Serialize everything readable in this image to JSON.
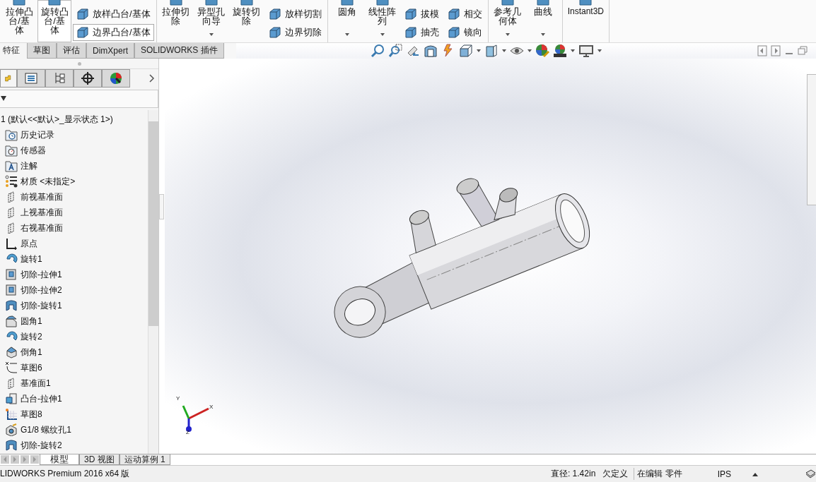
{
  "ribbon": {
    "groups": [
      {
        "items": [
          {
            "kind": "large",
            "label": "拉伸凸台/基体",
            "selected": false,
            "dropdown": false
          },
          {
            "kind": "large",
            "label": "旋转凸台/基体",
            "selected": true,
            "dropdown": false
          },
          {
            "kind": "column",
            "items": [
              {
                "label": "放样凸台/基体",
                "selected": false
              },
              {
                "label": "边界凸台/基体",
                "selected": true
              }
            ]
          }
        ]
      },
      {
        "items": [
          {
            "kind": "large",
            "label": "拉伸切除",
            "selected": false,
            "dropdown": false
          },
          {
            "kind": "large",
            "label": "异型孔向导",
            "selected": false,
            "dropdown": true
          },
          {
            "kind": "large",
            "label": "旋转切除",
            "selected": false,
            "dropdown": false
          },
          {
            "kind": "column",
            "items": [
              {
                "label": "放样切割",
                "selected": false
              },
              {
                "label": "边界切除",
                "selected": false
              }
            ]
          }
        ]
      },
      {
        "items": [
          {
            "kind": "large",
            "label": "圆角",
            "selected": false,
            "dropdown": true
          },
          {
            "kind": "large",
            "label": "线性阵列",
            "selected": false,
            "dropdown": true
          },
          {
            "kind": "column",
            "items": [
              {
                "label": "拔模",
                "selected": false
              },
              {
                "label": "抽壳",
                "selected": false
              }
            ]
          },
          {
            "kind": "column",
            "items": [
              {
                "label": "相交",
                "selected": false
              },
              {
                "label": "镜向",
                "selected": false
              }
            ]
          }
        ]
      },
      {
        "items": [
          {
            "kind": "large",
            "label": "参考几何体",
            "selected": false,
            "dropdown": true
          },
          {
            "kind": "large",
            "label": "曲线",
            "selected": false,
            "dropdown": true
          }
        ]
      },
      {
        "items": [
          {
            "kind": "wide",
            "label": "Instant3D",
            "selected": false,
            "dropdown": false
          }
        ]
      }
    ]
  },
  "command_tabs": [
    {
      "label": "特征",
      "selected": true
    },
    {
      "label": "草图",
      "selected": false
    },
    {
      "label": "评估",
      "selected": false
    },
    {
      "label": "DimXpert",
      "selected": false
    },
    {
      "label": "SOLIDWORKS 插件",
      "selected": false
    }
  ],
  "panel_tabs": [
    {
      "kind": "feature-tree",
      "selected": true
    },
    {
      "kind": "property",
      "selected": false
    },
    {
      "kind": "configuration",
      "selected": false
    },
    {
      "kind": "dimxpert",
      "selected": false
    },
    {
      "kind": "display",
      "selected": false
    }
  ],
  "tree": {
    "label": "1  (默认<<默认>_显示状态 1>)",
    "children": [
      {
        "kind": "history",
        "label": "历史记录"
      },
      {
        "kind": "sensor",
        "label": "传感器"
      },
      {
        "kind": "annotation",
        "label": "注解"
      },
      {
        "kind": "material",
        "label": "材质 <未指定>"
      },
      {
        "kind": "plane",
        "label": "前视基准面"
      },
      {
        "kind": "plane",
        "label": "上视基准面"
      },
      {
        "kind": "plane",
        "label": "右视基准面"
      },
      {
        "kind": "origin",
        "label": "原点"
      },
      {
        "kind": "revolve",
        "label": "旋转1"
      },
      {
        "kind": "cut-extrude",
        "label": "切除-拉伸1"
      },
      {
        "kind": "cut-extrude",
        "label": "切除-拉伸2"
      },
      {
        "kind": "cut-revolve",
        "label": "切除-旋转1"
      },
      {
        "kind": "fillet",
        "label": "圆角1"
      },
      {
        "kind": "revolve",
        "label": "旋转2"
      },
      {
        "kind": "chamfer",
        "label": "倒角1"
      },
      {
        "kind": "sketch",
        "label": "草图6"
      },
      {
        "kind": "plane",
        "label": "基准面1"
      },
      {
        "kind": "boss-extrude",
        "label": "凸台-拉伸1"
      },
      {
        "kind": "sketch3d",
        "label": "草图8"
      },
      {
        "kind": "hole",
        "label": "G1/8 螺纹孔1"
      },
      {
        "kind": "cut-revolve",
        "label": "切除-旋转2"
      }
    ]
  },
  "triad": {
    "x": "X",
    "y": "Y",
    "z": "Z"
  },
  "bottom_tabs": [
    {
      "label": "模型",
      "selected": true
    },
    {
      "label": "3D 视图",
      "selected": false
    },
    {
      "label": "运动算例 1",
      "selected": false
    }
  ],
  "status_bar": {
    "product": "LIDWORKS Premium 2016 x64 版",
    "measure": "直径: 1.42in",
    "state": "欠定义",
    "mode": "在编辑 零件",
    "units": "IPS"
  }
}
